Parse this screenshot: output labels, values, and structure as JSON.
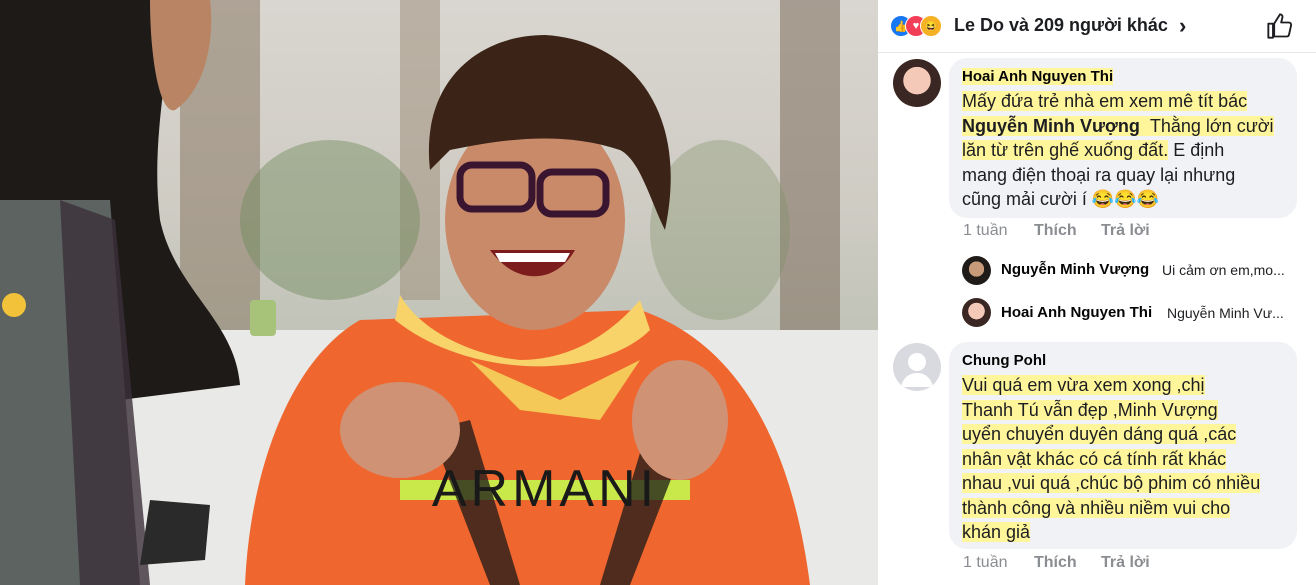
{
  "reactions": {
    "icons": [
      "like-icon",
      "love-icon",
      "haha-icon"
    ],
    "summary": "Le Do và 209 người khác"
  },
  "photo": {
    "shirt_text": "ARMANI"
  },
  "comments": [
    {
      "author": "Hoai Anh Nguyen Thi",
      "lines": [
        "Mấy đứa trẻ nhà em xem mê tít bác",
        "Nguyễn Minh Vượng",
        "Thằng lớn cười",
        "lăn từ trên ghế xuống đất.",
        "E định",
        "mang điện thoại ra quay lại nhưng",
        "cũng mải cười í 😂😂😂"
      ],
      "time": "1 tuần",
      "like_label": "Thích",
      "reply_label": "Trả lời",
      "replies": [
        {
          "author": "Nguyễn Minh Vượng",
          "text": "Ui cảm ơn em,mo..."
        },
        {
          "author": "Hoai Anh Nguyen Thi",
          "text": "Nguyễn Minh Vư..."
        }
      ]
    },
    {
      "author": "Chung Pohl",
      "lines": [
        "Vui quá  em vừa xem xong ,chị",
        "Thanh Tú vẫn đẹp  ,Minh  Vượng",
        "uyển chuyển duyên dáng quá  ,các",
        "nhân vật khác có cá tính rất khác",
        "nhau ,vui quá  ,chúc bộ phim có nhiều",
        "thành công và nhiều niềm vui cho",
        "khán giả"
      ],
      "time": "1 tuần",
      "like_label": "Thích",
      "reply_label": "Trả lời"
    }
  ],
  "colors": {
    "highlight": "#fff59a",
    "bubble": "#f0f2f5",
    "like": "#1877f2",
    "love": "#f33e58",
    "haha": "#f7b125"
  }
}
